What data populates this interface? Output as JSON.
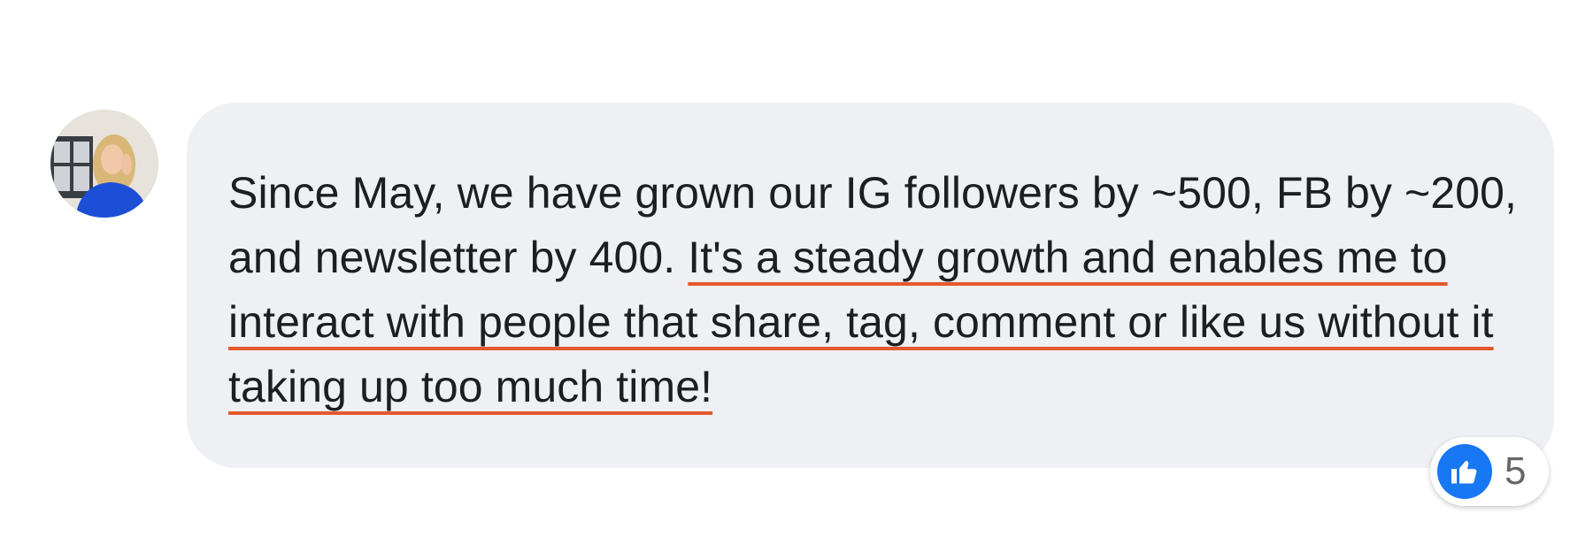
{
  "comment": {
    "text_part1": "Since May, we have grown our IG followers by ~500, FB by ~200, and newsletter by 400. ",
    "text_highlight": "It's a steady growth and enables me to interact with people that share, tag, comment or like us without it taking up too much time!"
  },
  "reactions": {
    "icon": "thumbs-up-icon",
    "count": "5"
  },
  "colors": {
    "bubble": "#eff0f3",
    "underline": "#e25a2c",
    "like_blue": "#1877f2",
    "text": "#1c1e21"
  }
}
